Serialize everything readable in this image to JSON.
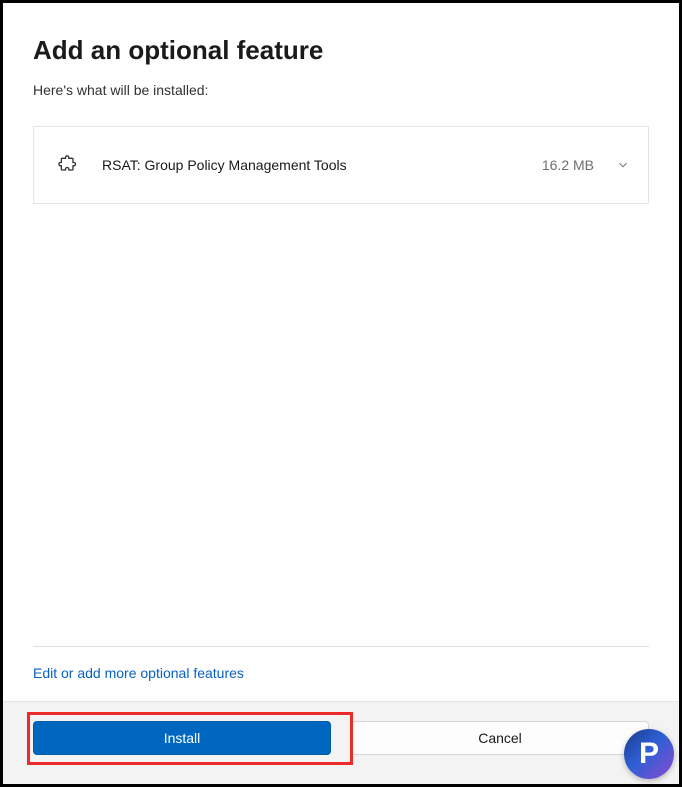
{
  "header": {
    "title": "Add an optional feature",
    "subtitle": "Here's what will be installed:"
  },
  "features": [
    {
      "name": "RSAT: Group Policy Management Tools",
      "size": "16.2 MB"
    }
  ],
  "links": {
    "edit_features": "Edit or add more optional features"
  },
  "buttons": {
    "install": "Install",
    "cancel": "Cancel"
  },
  "logo": {
    "letter": "P"
  }
}
